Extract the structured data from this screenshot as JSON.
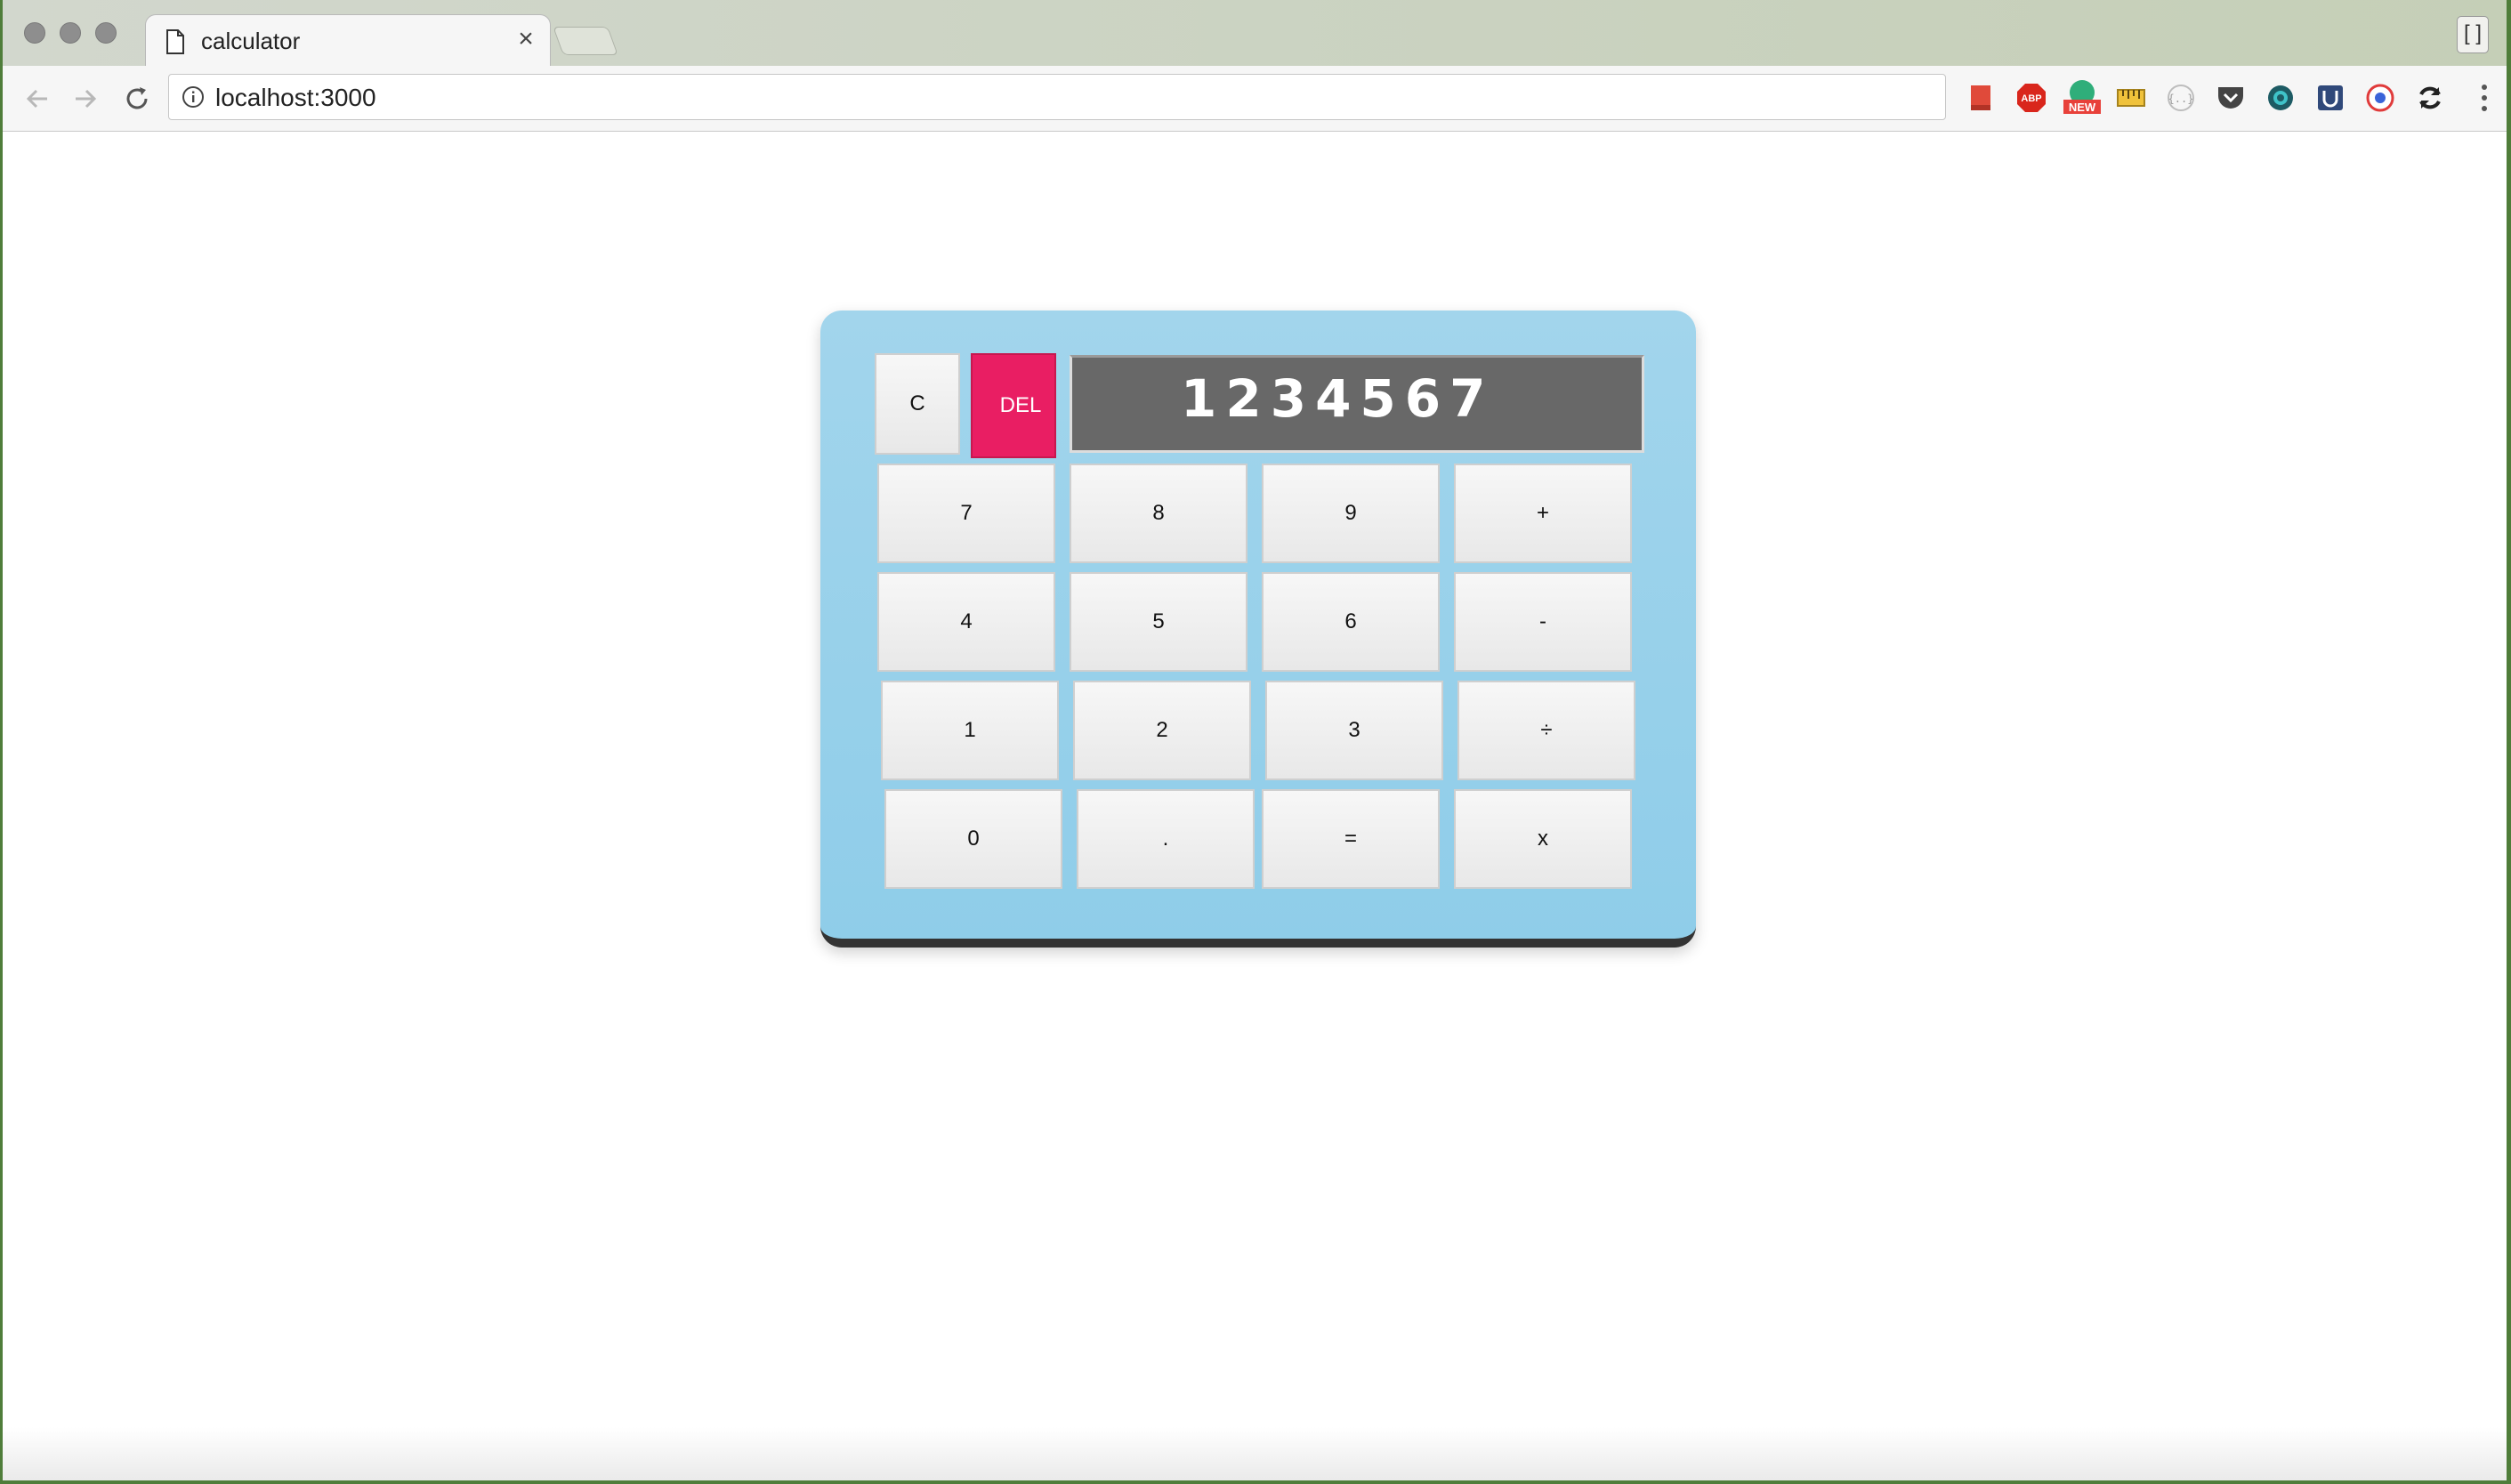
{
  "browser": {
    "tab_title": "calculator",
    "tab_close": "×",
    "url": "localhost:3000",
    "profile_label": "[ ]",
    "extensions": [
      "bookmark-icon",
      "adblock-icon",
      "new-badge-icon",
      "ruler-icon",
      "json-icon",
      "pocket-icon",
      "dashboard-icon",
      "ublock-icon",
      "search-ext-icon",
      "sync-icon"
    ]
  },
  "calculator": {
    "display": "1234567",
    "clear_label": "C",
    "delete_label": "DEL",
    "rows": [
      [
        "7",
        "8",
        "9",
        "+"
      ],
      [
        "4",
        "5",
        "6",
        "-"
      ],
      [
        "1",
        "2",
        "3",
        "÷"
      ],
      [
        "0",
        ".",
        "=",
        "x"
      ]
    ]
  },
  "colors": {
    "calculator_bg": "#96d0ea",
    "delete_button": "#e91e63",
    "display_bg": "#686868",
    "calculator_base": "#333333"
  }
}
